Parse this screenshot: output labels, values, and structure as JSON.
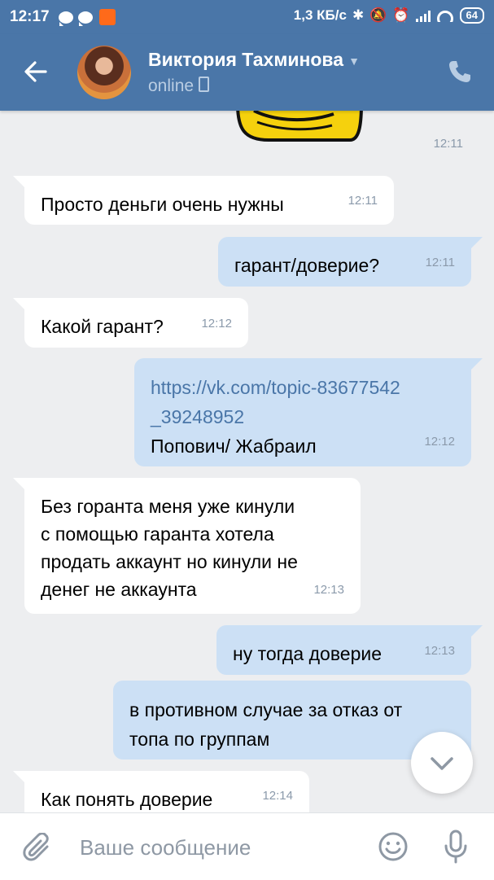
{
  "status_bar": {
    "time": "12:17",
    "net_speed": "1,3 КБ/с",
    "battery": "64"
  },
  "header": {
    "contact_name": "Виктория Тахминова",
    "contact_status": "online"
  },
  "messages": [
    {
      "direction": "in",
      "text": "Просто деньги очень нужны",
      "time": "12:11"
    },
    {
      "direction": "out",
      "text": "гарант/доверие?",
      "time": "12:11"
    },
    {
      "direction": "in",
      "text": "Какой гарант?",
      "time": "12:12"
    },
    {
      "direction": "out",
      "link_line1": "https://vk.com/topic-83677542",
      "link_line2": "_39248952",
      "text": "Попович/ Жабраил",
      "time": "12:12"
    },
    {
      "direction": "in",
      "lines": [
        "Без горанта меня уже кинули",
        "с помощью гаранта хотела",
        "продать аккаунт но кинули не",
        "денег не аккаунта"
      ],
      "time": "12:13"
    },
    {
      "direction": "out",
      "text": "ну тогда доверие",
      "time": "12:13"
    },
    {
      "direction": "out",
      "lines": [
        "в противном случае за отказ от",
        "топа по группам"
      ]
    },
    {
      "direction": "in",
      "text": "Как понять доверие",
      "time": "12:14"
    }
  ],
  "sticker": {
    "time": "12:11"
  },
  "composer": {
    "placeholder": "Ваше сообщение"
  },
  "colors": {
    "header": "#4a76a8",
    "chat_bg": "#edeef0",
    "bubble_out": "#cce0f5",
    "bubble_in": "#ffffff",
    "link": "#4a76a8"
  }
}
